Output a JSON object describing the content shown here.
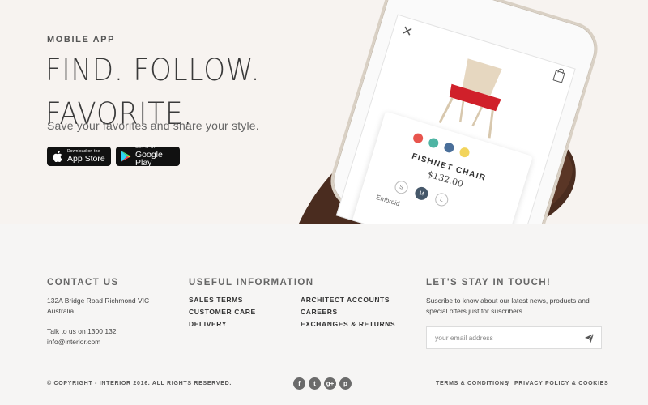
{
  "hero": {
    "eyebrow": "MOBILE APP",
    "title_line1": "FIND. FOLLOW.",
    "title_line2": "FAVORITE.",
    "subtitle": "Save your favorites and share your style.",
    "app_store": {
      "small": "Download on the",
      "big": "App Store"
    },
    "google_play": {
      "small": "GET IT ON",
      "big": "Google Play"
    }
  },
  "phone": {
    "product_name": "FISHNET CHAIR",
    "price": "$132.00",
    "swatch_colors": [
      "#e8554e",
      "#4fb5a4",
      "#4a6f9a",
      "#f2d45c"
    ],
    "sizes": [
      "S",
      "M",
      "L"
    ],
    "selected_size": "M",
    "detail_text": "Embroid"
  },
  "footer": {
    "contact": {
      "heading": "CONTACT US",
      "address_line1": "132A Bridge Road Richmond VIC",
      "address_line2": "Australia.",
      "phone_line": "Talk to us on 1300 132",
      "email": "info@interior.com"
    },
    "useful": {
      "heading": "USEFUL INFORMATION",
      "links_col1": [
        "SALES TERMS",
        "CUSTOMER CARE",
        "DELIVERY"
      ],
      "links_col2": [
        "ARCHITECT ACCOUNTS",
        "CAREERS",
        "EXCHANGES & RETURNS"
      ]
    },
    "newsletter": {
      "heading": "LET'S STAY IN TOUCH!",
      "text_line1": "Suscribe to know about our latest news, products and",
      "text_line2": "special offers just for suscribers.",
      "email_placeholder": "your email address",
      "send_icon": "paper-plane-icon"
    },
    "copyright": "© COPYRIGHT - INTERIOR 2016. ALL RIGHTS RESERVED.",
    "socials": [
      {
        "name": "facebook-icon",
        "glyph": "f"
      },
      {
        "name": "twitter-icon",
        "glyph": "t"
      },
      {
        "name": "google-plus-icon",
        "glyph": "g+"
      },
      {
        "name": "pinterest-icon",
        "glyph": "p"
      }
    ],
    "legal": {
      "terms": "TERMS & CONDITIONS",
      "separator": "/",
      "privacy": "PRIVACY POLICY & COOKIES"
    }
  },
  "colors": {
    "hero_bg": "#f7f3f0",
    "footer_bg": "#f6f5f4",
    "chair_red": "#d0202a",
    "social_bg": "#6b6b6b"
  }
}
